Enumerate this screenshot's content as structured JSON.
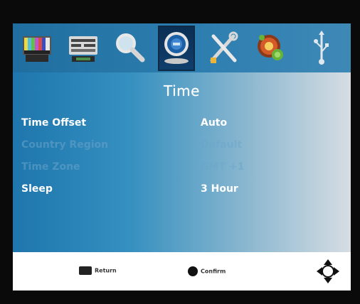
{
  "menu": {
    "title": "Time",
    "icons": [
      {
        "name": "picture-icon"
      },
      {
        "name": "sound-icon"
      },
      {
        "name": "search-icon"
      },
      {
        "name": "time-icon",
        "selected": true
      },
      {
        "name": "setup-tools-icon"
      },
      {
        "name": "parental-lock-icon"
      },
      {
        "name": "usb-icon"
      }
    ],
    "items": [
      {
        "label": "Time Offset",
        "value": "Auto",
        "state": "active"
      },
      {
        "label": "Country Region",
        "value": "Default",
        "state": "disabled"
      },
      {
        "label": "Time Zone",
        "value": "GMT +1",
        "state": "disabled"
      },
      {
        "label": "Sleep",
        "value": "3 Hour",
        "state": "active"
      }
    ]
  },
  "footer": {
    "return_label": "Return",
    "confirm_label": "Confirm",
    "nav_icon": "dpad-icon"
  },
  "colors": {
    "accent": "#1e76ad",
    "text_active": "#ffffff",
    "background": "#0a0a0a"
  }
}
